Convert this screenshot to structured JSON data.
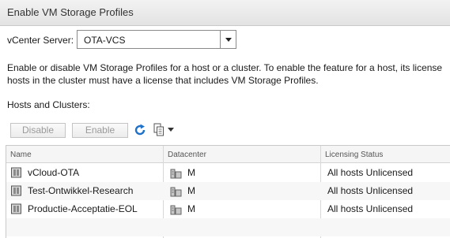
{
  "dialog": {
    "title": "Enable VM Storage Profiles"
  },
  "vcenter": {
    "label": "vCenter Server:",
    "selected": "OTA-VCS"
  },
  "description": {
    "line1": "Enable or disable VM Storage Profiles for a host or a cluster. To enable the feature for a host, its license",
    "line2": "hosts in the cluster must have a license that includes VM Storage Profiles."
  },
  "hosts": {
    "label": "Hosts and Clusters:"
  },
  "toolbar": {
    "disable_label": "Disable",
    "enable_label": "Enable",
    "refresh_icon": "refresh-icon",
    "copy_icon": "copy-icon"
  },
  "table": {
    "columns": [
      "Name",
      "Datacenter",
      "Licensing Status"
    ],
    "rows": [
      {
        "name": "vCloud-OTA",
        "datacenter": "M",
        "licensing": "All hosts Unlicensed"
      },
      {
        "name": "Test-Ontwikkel-Research",
        "datacenter": "M",
        "licensing": "All hosts Unlicensed"
      },
      {
        "name": "Productie-Acceptatie-EOL",
        "datacenter": "M",
        "licensing": "All hosts Unlicensed"
      }
    ]
  },
  "colors": {
    "refresh_blue": "#1f72c8",
    "title_bg": "#e8e8e8"
  }
}
